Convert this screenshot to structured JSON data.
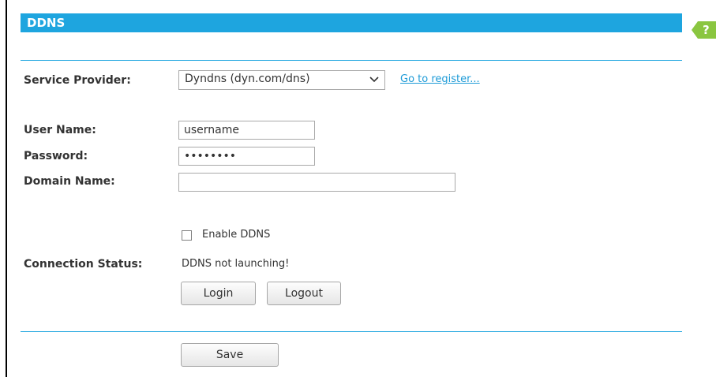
{
  "header": {
    "title": "DDNS",
    "help_label": "?"
  },
  "service_provider": {
    "label": "Service Provider:",
    "selected": "Dyndns (dyn.com/dns)",
    "register_link": "Go to register..."
  },
  "user_name": {
    "label": "User Name:",
    "value": "username"
  },
  "password": {
    "label": "Password:",
    "value": "password"
  },
  "domain_name": {
    "label": "Domain Name:",
    "value": ""
  },
  "enable_ddns": {
    "label": "Enable DDNS",
    "checked": false
  },
  "connection_status": {
    "label": "Connection Status:",
    "value": "DDNS not launching!",
    "login_label": "Login",
    "logout_label": "Logout"
  },
  "footer": {
    "save_label": "Save"
  },
  "colors": {
    "accent": "#1ea5df",
    "help_tab": "#8ac640",
    "link": "#1e9bd7"
  }
}
